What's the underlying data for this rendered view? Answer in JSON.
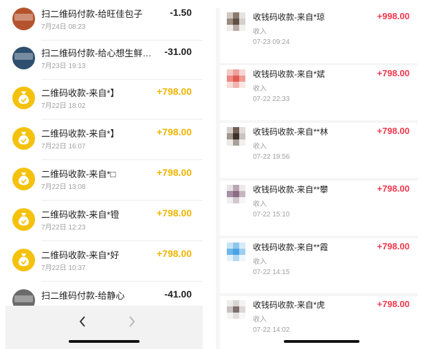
{
  "left": {
    "rows": [
      {
        "title": "扫二维码付款-给旺佳包子",
        "date": "7月24日 08:23",
        "amount": "-1.50",
        "kind": "neg",
        "avatar": "photo-avatar",
        "avatar_color": "#b5532e"
      },
      {
        "title": "扫二维码付款-给心想生鲜…",
        "date": "7月23日 19:13",
        "amount": "-31.00",
        "kind": "neg",
        "avatar": "photo-avatar",
        "avatar_color": "#2f4f6f"
      },
      {
        "title": "二维码收款-来自*】",
        "date": "7月22日 18:02",
        "amount": "+798.00",
        "kind": "pos",
        "avatar": "money-bag-icon"
      },
      {
        "title": "二维码收款-来自*】",
        "date": "7月22日 16:07",
        "amount": "+798.00",
        "kind": "pos",
        "avatar": "money-bag-icon"
      },
      {
        "title": "二维码收款-来自*□",
        "date": "7月22日 13:08",
        "amount": "+798.00",
        "kind": "pos",
        "avatar": "money-bag-icon"
      },
      {
        "title": "二维码收款-来自*镫",
        "date": "7月22日 12:23",
        "amount": "+798.00",
        "kind": "pos",
        "avatar": "money-bag-icon"
      },
      {
        "title": "二维码收款-来自*好",
        "date": "7月22日 10:37",
        "amount": "+798.00",
        "kind": "pos",
        "avatar": "money-bag-icon"
      },
      {
        "title": "扫二维码付款-给静心",
        "date": "",
        "amount": "-41.00",
        "kind": "neg",
        "avatar": "photo-avatar",
        "avatar_color": "#6b6b6b"
      }
    ],
    "nav": {
      "back_icon": "chevron-left-icon",
      "forward_icon": "chevron-right-icon"
    }
  },
  "right": {
    "rows": [
      {
        "title": "收钱码收款-来自*琼",
        "type": "收入",
        "date": "07-23 09:24",
        "amount": "+998.00",
        "colors": [
          "#cfc8c3",
          "#8a7a6e",
          "#e7e2de",
          "#9b8b7f",
          "#5e4e43",
          "#d6cfca",
          "#efecea",
          "#b8aca4",
          "#f3f1ef"
        ]
      },
      {
        "title": "收钱码收款-来自*斌",
        "type": "收入",
        "date": "07-22 22:33",
        "amount": "+798.00",
        "colors": [
          "#f4c9c6",
          "#ef9f9a",
          "#f6d6d3",
          "#ec8a84",
          "#e35a55",
          "#f09b96",
          "#f7dcda",
          "#f1b3ae",
          "#fae7e5"
        ]
      },
      {
        "title": "收钱码收款-来自**林",
        "type": "收入",
        "date": "07-22 19:56",
        "amount": "+798.00",
        "colors": [
          "#d5d0cd",
          "#6f5f55",
          "#e1dcd9",
          "#a09790",
          "#3e3129",
          "#c9c2bd",
          "#ece9e7",
          "#a9a09a",
          "#f2f0ee"
        ]
      },
      {
        "title": "收钱码收款-来自**攀",
        "type": "收入",
        "date": "07-22 15:10",
        "amount": "+798.00",
        "colors": [
          "#e7e3e6",
          "#b9a6b4",
          "#ede9ec",
          "#a58fa0",
          "#8b6c85",
          "#c5b5c1",
          "#f1eef0",
          "#d2c6cf",
          "#f6f4f5"
        ]
      },
      {
        "title": "收钱码收款-来自**霞",
        "type": "收入",
        "date": "07-22 14:15",
        "amount": "+798.00",
        "colors": [
          "#c8e3f6",
          "#8ec6ee",
          "#d7ebf8",
          "#6fb6ea",
          "#4aa4e4",
          "#9ccdf0",
          "#e3f1fa",
          "#b3d8f3",
          "#eef7fc"
        ]
      },
      {
        "title": "收钱码收款-来自*虎",
        "type": "收入",
        "date": "07-22 14:02",
        "amount": "+798.00",
        "colors": [
          "#eeeded",
          "#d9d3d3",
          "#f3f2f2",
          "#c9c1c1",
          "#7e6e6e",
          "#dcd6d6",
          "#f5f4f4",
          "#e4dfdf",
          "#f8f7f7"
        ]
      }
    ]
  }
}
